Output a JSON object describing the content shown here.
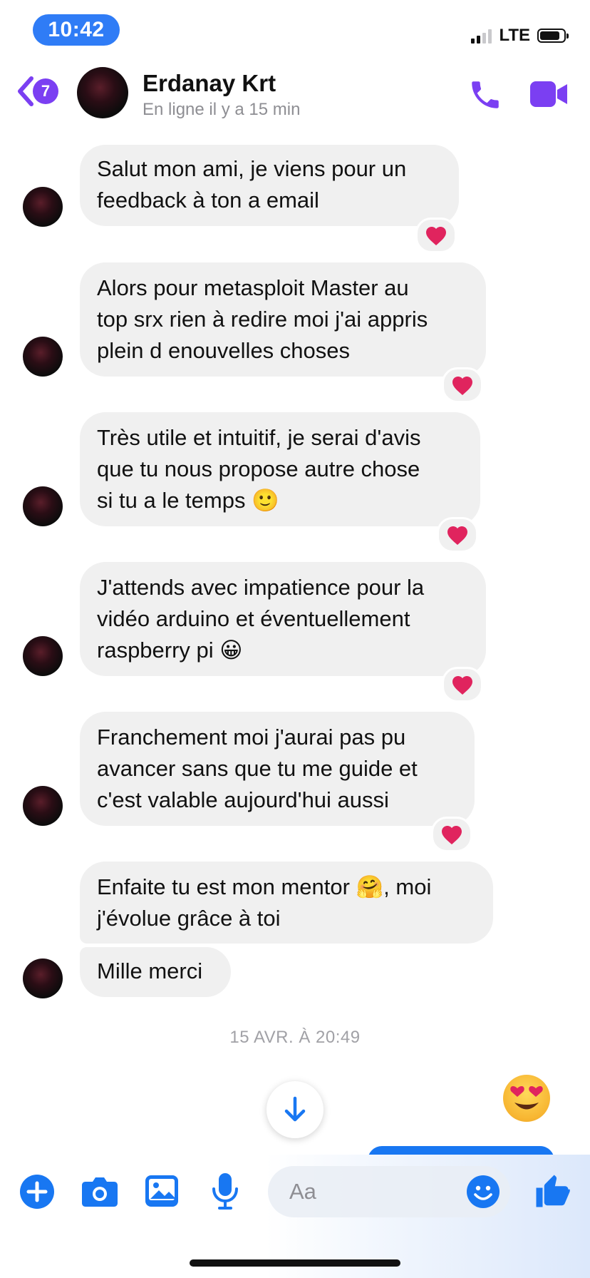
{
  "status_bar": {
    "time": "10:42",
    "network": "LTE",
    "battery_level": 0.85,
    "signal_bars": 2
  },
  "header": {
    "back_badge": "7",
    "contact_name": "Erdanay Krt",
    "presence": "En ligne il y a 15 min"
  },
  "messages": [
    {
      "text": "Salut mon ami, je viens pour un\nfeedback à ton a email",
      "reaction": "heart"
    },
    {
      "text": "Alors pour metasploit Master au\ntop srx rien à redire moi j'ai appris\nplein d enouvelles choses",
      "reaction": "heart"
    },
    {
      "text": "Très utile et intuitif, je serai d'avis\nque tu nous propose autre chose\nsi tu a le temps 🙂",
      "reaction": "heart"
    },
    {
      "text": "J'attends avec impatience pour la\nvidéo arduino et éventuellement\nraspberry pi 😀",
      "reaction": "heart"
    },
    {
      "text": "Franchement moi j'aurai pas pu\navancer sans que tu me guide et\nc'est valable aujourd'hui aussi",
      "reaction": "heart"
    },
    {
      "text": "Enfaite tu est mon mentor 🤗, moi\nj'évolue grâce à toi"
    },
    {
      "text": "Mille merci"
    }
  ],
  "timestamp": "15 AVR. À 20:49",
  "composer": {
    "placeholder": "Aa"
  },
  "colors": {
    "accent_purple": "#7b3ff2",
    "messenger_blue": "#1877f2",
    "bubble_grey": "#f0f0f0",
    "heart_red": "#e0245e"
  },
  "icons": [
    "back-chevron-icon",
    "phone-icon",
    "video-camera-icon",
    "plus-icon",
    "camera-icon",
    "image-icon",
    "microphone-icon",
    "emoji-icon",
    "thumbs-up-icon",
    "arrow-down-icon",
    "heart-eyes-emoji-icon",
    "heart-icon"
  ]
}
